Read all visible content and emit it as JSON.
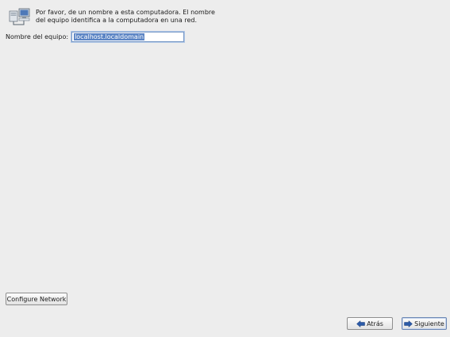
{
  "intro": {
    "line1": "Por favor, de un nombre a esta computadora. El nombre",
    "line2": "del equipo identifica a la computadora en una red."
  },
  "hostname": {
    "label": "Nombre del equipo:",
    "value": "localhost.localdomain"
  },
  "buttons": {
    "configure_network": "Configure Network",
    "back": "Atrás",
    "next": "Siguiente"
  },
  "icons": {
    "network": "network-computers-icon",
    "back": "arrow-left-icon",
    "next": "arrow-right-icon"
  },
  "colors": {
    "background": "#ededed",
    "selection": "#5b84c4",
    "arrow": "#2b5aa8"
  }
}
